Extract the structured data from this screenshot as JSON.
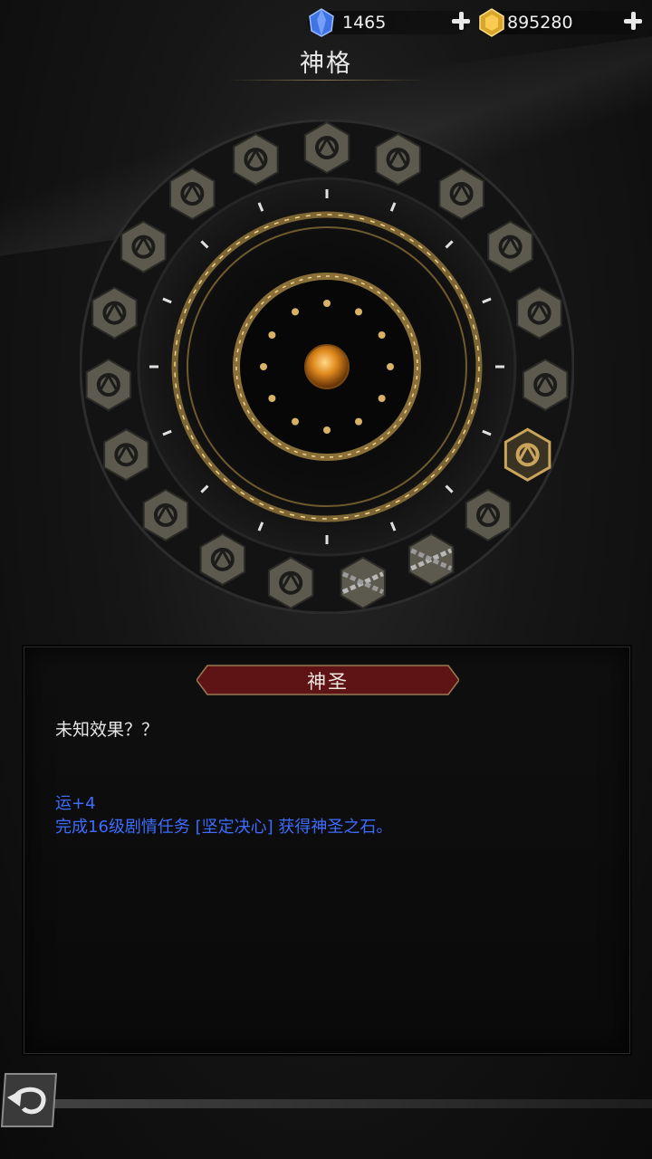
{
  "currency": {
    "gems": "1465",
    "gold": "895280",
    "gem_icon": "blue-crystal-icon",
    "gold_icon": "gold-crystal-icon"
  },
  "page": {
    "title": "神格"
  },
  "wheel": {
    "slot_icons": [
      "rune-icon",
      "rune-icon",
      "rune-icon",
      "rune-icon",
      "rune-icon",
      "rune-icon",
      "selected-rune-icon",
      "rune-icon",
      "locked-chain-icon",
      "locked-chain-icon",
      "rune-icon",
      "rune-icon",
      "rune-icon",
      "rune-icon",
      "rune-icon",
      "rune-icon",
      "rune-icon",
      "rune-icon",
      "rune-icon"
    ],
    "center_icon": "amber-orb-icon",
    "accent_color": "#c9a45a"
  },
  "detail": {
    "name": "神圣",
    "description": "未知效果？？",
    "effect_line1": "运+4",
    "effect_line2": "完成16级剧情任务 [坚定决心] 获得神圣之石。",
    "effect_color": "#3d6cff"
  },
  "nav": {
    "back_icon": "back-arrow-icon"
  }
}
